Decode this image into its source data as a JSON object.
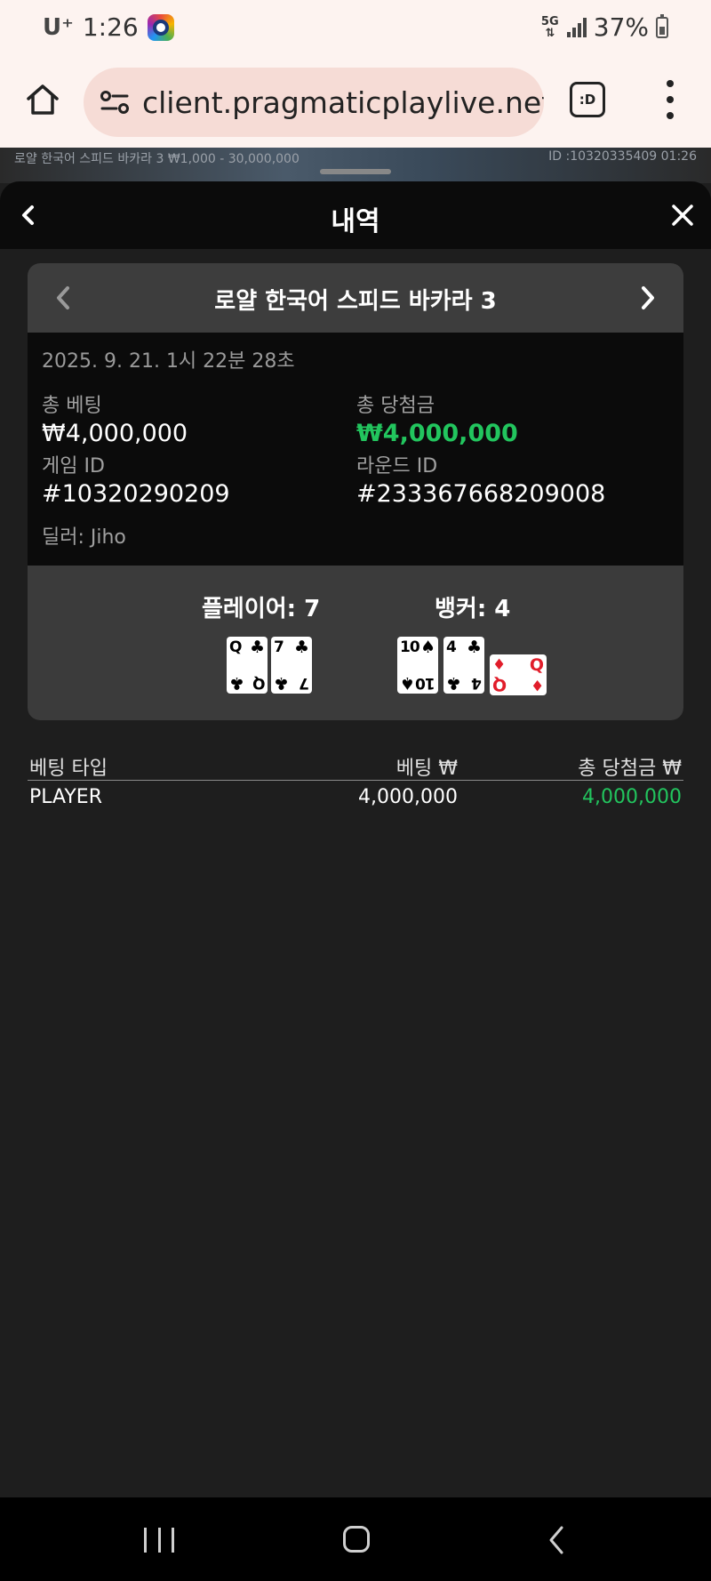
{
  "status_bar": {
    "carrier": "U⁺",
    "time": "1:26",
    "network": "5G",
    "battery": "37%"
  },
  "browser": {
    "url": "client.pragmaticplaylive.net/c",
    "tabs_label": ":D"
  },
  "game_strip": {
    "table_name": "로얄 한국어 스피드 바카라 3 ₩1,000 - 30,000,000",
    "game_id": "ID :10320335409 01:26"
  },
  "modal": {
    "title": "내역"
  },
  "round": {
    "table_name": "로얄 한국어 스피드 바카라 3",
    "date": "2025. 9. 21. 1시 22분 28초",
    "total_bet_label": "총 베팅",
    "total_bet": "₩4,000,000",
    "total_win_label": "총 당첨금",
    "total_win": "₩4,000,000",
    "game_id_label": "게임 ID",
    "game_id": "#10320290209",
    "round_id_label": "라운드 ID",
    "round_id": "#233367668209008",
    "dealer": "딜러: Jiho",
    "player_label": "플레이어: 7",
    "banker_label": "뱅커: 4",
    "player_cards": [
      {
        "rank": "Q",
        "suit": "♣",
        "color": "#000000"
      },
      {
        "rank": "7",
        "suit": "♣",
        "color": "#000000"
      }
    ],
    "banker_cards": [
      {
        "rank": "10",
        "suit": "♠",
        "color": "#000000"
      },
      {
        "rank": "4",
        "suit": "♣",
        "color": "#000000"
      },
      {
        "rank": "Q",
        "suit": "♦",
        "color": "#e11d2a"
      }
    ]
  },
  "bets": {
    "headers": [
      "베팅 타입",
      "베팅 ₩",
      "총 당첨금 ₩"
    ],
    "rows": [
      {
        "type": "PLAYER",
        "bet": "4,000,000",
        "win": "4,000,000"
      }
    ]
  },
  "colors": {
    "win_green": "#22c55e",
    "panel_dark": "#0b0b0b",
    "panel_gray": "#3b3b3b"
  }
}
